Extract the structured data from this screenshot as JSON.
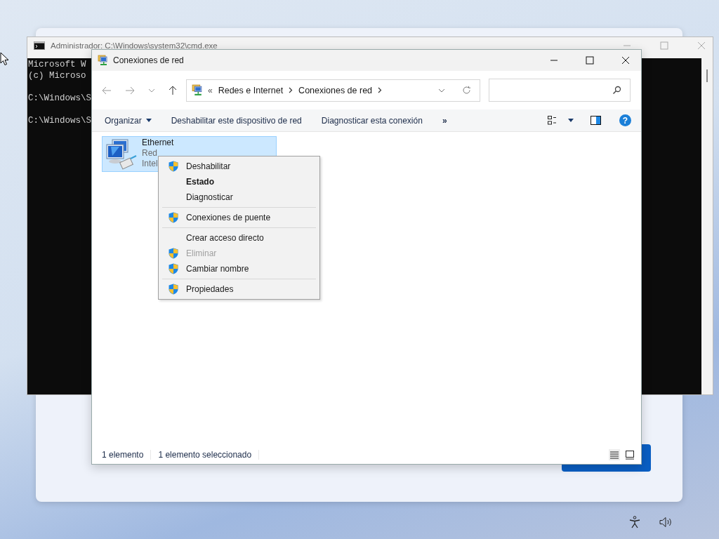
{
  "console_window": {
    "title": "Administrador: C:\\Windows\\system32\\cmd.exe",
    "blocks": [
      [
        "Microsoft W",
        "(c) Microso"
      ],
      [
        "C:\\Windows\\S"
      ],
      [
        "C:\\Windows\\S"
      ]
    ]
  },
  "explorer_window": {
    "title": "Conexiones de red",
    "address": {
      "overflow": "«",
      "crumbs": [
        "Redes e Internet",
        "Conexiones de red"
      ]
    },
    "commands": [
      {
        "label": "Organizar",
        "kind": "menu"
      },
      {
        "label": "Deshabilitar este dispositivo de red",
        "kind": "plain"
      },
      {
        "label": "Diagnosticar esta conexión",
        "kind": "plain"
      },
      {
        "label": "»",
        "kind": "more"
      }
    ],
    "help": "?",
    "items": [
      {
        "name": "Ethernet",
        "lines": [
          "Red",
          "Intel"
        ],
        "selected": true
      }
    ],
    "status_bar": [
      "1 elemento",
      "1 elemento seleccionado"
    ]
  },
  "context_menu": [
    [
      {
        "label": "Deshabilitar",
        "shield": true,
        "default": false,
        "disabled": false
      },
      {
        "label": "Estado",
        "shield": false,
        "default": true,
        "disabled": false
      },
      {
        "label": "Diagnosticar",
        "shield": false,
        "default": false,
        "disabled": false
      }
    ],
    [
      {
        "label": "Conexiones de puente",
        "shield": true,
        "default": false,
        "disabled": false
      }
    ],
    [
      {
        "label": "Crear acceso directo",
        "shield": false,
        "default": false,
        "disabled": false
      },
      {
        "label": "Eliminar",
        "shield": true,
        "default": false,
        "disabled": true
      },
      {
        "label": "Cambiar nombre",
        "shield": true,
        "default": false,
        "disabled": false
      }
    ],
    [
      {
        "label": "Propiedades",
        "shield": true,
        "default": false,
        "disabled": false
      }
    ]
  ]
}
